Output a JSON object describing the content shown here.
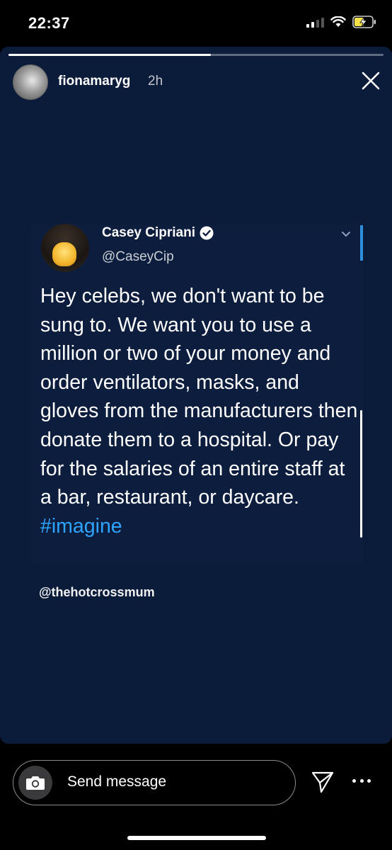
{
  "status_bar": {
    "time": "22:37",
    "icons": [
      "signal-icon",
      "wifi-icon",
      "battery-charging-icon"
    ]
  },
  "story": {
    "progress": 0.54,
    "username": "fionamaryg",
    "time_ago": "2h",
    "close_icon": "close-icon",
    "background_color": "#0b1b3a"
  },
  "tweet": {
    "display_name": "Casey Cipriani",
    "handle": "@CaseyCip",
    "verified": true,
    "body": "Hey celebs, we don't want to be sung to. We want you to use a million or two of your money and order ventilators, masks, and gloves from the manufacturers then donate them to a hospital. Or pay for the salaries of an entire staff at a bar, restaurant, or daycare.",
    "hashtag": "#imagine",
    "hashtag_color": "#2ea4ff"
  },
  "credit": "@thehotcrossmum",
  "bottom_bar": {
    "message_placeholder": "Send message",
    "icons": [
      "camera-icon",
      "send-icon",
      "more-icon"
    ]
  }
}
